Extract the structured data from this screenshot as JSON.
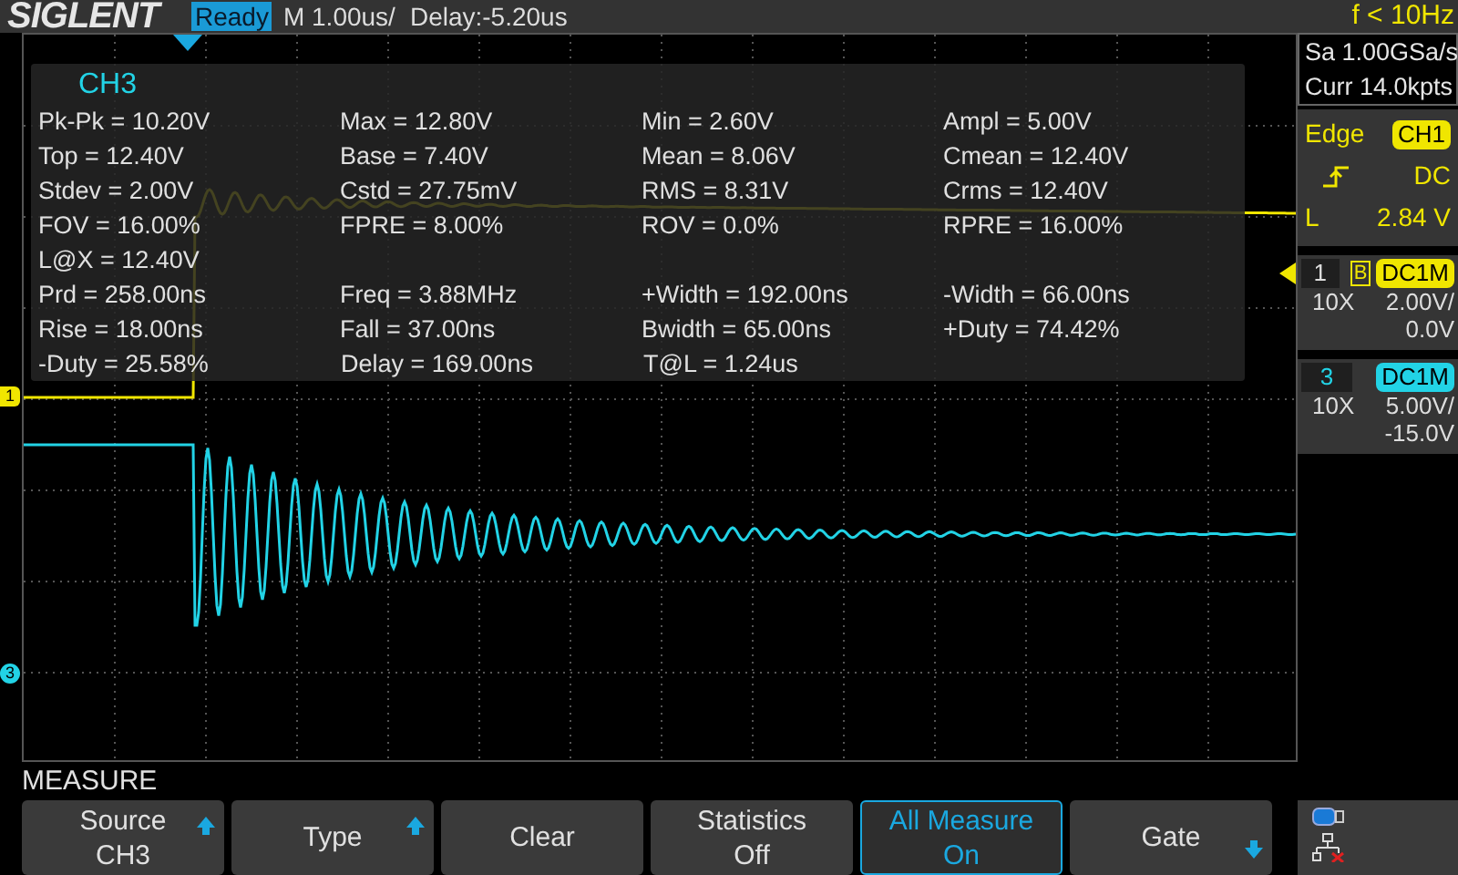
{
  "header": {
    "brand": "SIGLENT",
    "status": "Ready",
    "timebase": "M 1.00us/",
    "delay": "Delay:-5.20us",
    "trigger_frequency": "f < 10Hz"
  },
  "acquisition": {
    "sample_rate": "Sa 1.00GSa/s",
    "memory": "Curr 14.0kpts"
  },
  "trigger": {
    "type": "Edge",
    "source": "CH1",
    "coupling": "DC",
    "level_label": "L",
    "level_value": "2.84 V"
  },
  "channels": [
    {
      "number": "1",
      "marker": "1",
      "color": "#f0e600",
      "bandwidth_limit": "B",
      "coupling": "DC1M",
      "probe": "10X",
      "scale": "2.00V/",
      "offset": "0.0V"
    },
    {
      "number": "3",
      "marker": "3",
      "color": "#22d3e6",
      "coupling": "DC1M",
      "probe": "10X",
      "scale": "5.00V/",
      "offset": "-15.0V"
    }
  ],
  "measure_panel": {
    "source": "CH3",
    "rows": [
      [
        "Pk-Pk = 10.20V",
        "Max = 12.80V",
        "Min = 2.60V",
        "Ampl = 5.00V"
      ],
      [
        "Top = 12.40V",
        "Base = 7.40V",
        "Mean = 8.06V",
        "Cmean = 12.40V"
      ],
      [
        "Stdev = 2.00V",
        "Cstd = 27.75mV",
        "RMS = 8.31V",
        "Crms = 12.40V"
      ],
      [
        "FOV = 16.00%",
        "FPRE = 8.00%",
        "ROV = 0.0%",
        "RPRE = 16.00%"
      ],
      [
        "L@X = 12.40V"
      ],
      [
        "Prd = 258.00ns",
        "Freq = 3.88MHz",
        "+Width = 192.00ns",
        "-Width = 66.00ns"
      ],
      [
        "Rise = 18.00ns",
        "Fall = 37.00ns",
        "Bwidth = 65.00ns",
        "+Duty = 74.42%"
      ],
      [
        "-Duty = 25.58%",
        "Delay = 169.00ns",
        "T@L = 1.24us"
      ]
    ]
  },
  "menu": {
    "title": "MEASURE",
    "buttons": [
      {
        "label": "Source",
        "value": "CH3",
        "kind": "up",
        "selected": false
      },
      {
        "label": "Type",
        "kind": "up",
        "selected": false
      },
      {
        "label": "Clear",
        "kind": "plain",
        "selected": false
      },
      {
        "label": "Statistics",
        "value": "Off",
        "kind": "plain",
        "selected": false
      },
      {
        "label": "All Measure",
        "value": "On",
        "kind": "plain",
        "selected": true
      },
      {
        "label": "Gate",
        "kind": "down",
        "selected": false
      }
    ]
  }
}
